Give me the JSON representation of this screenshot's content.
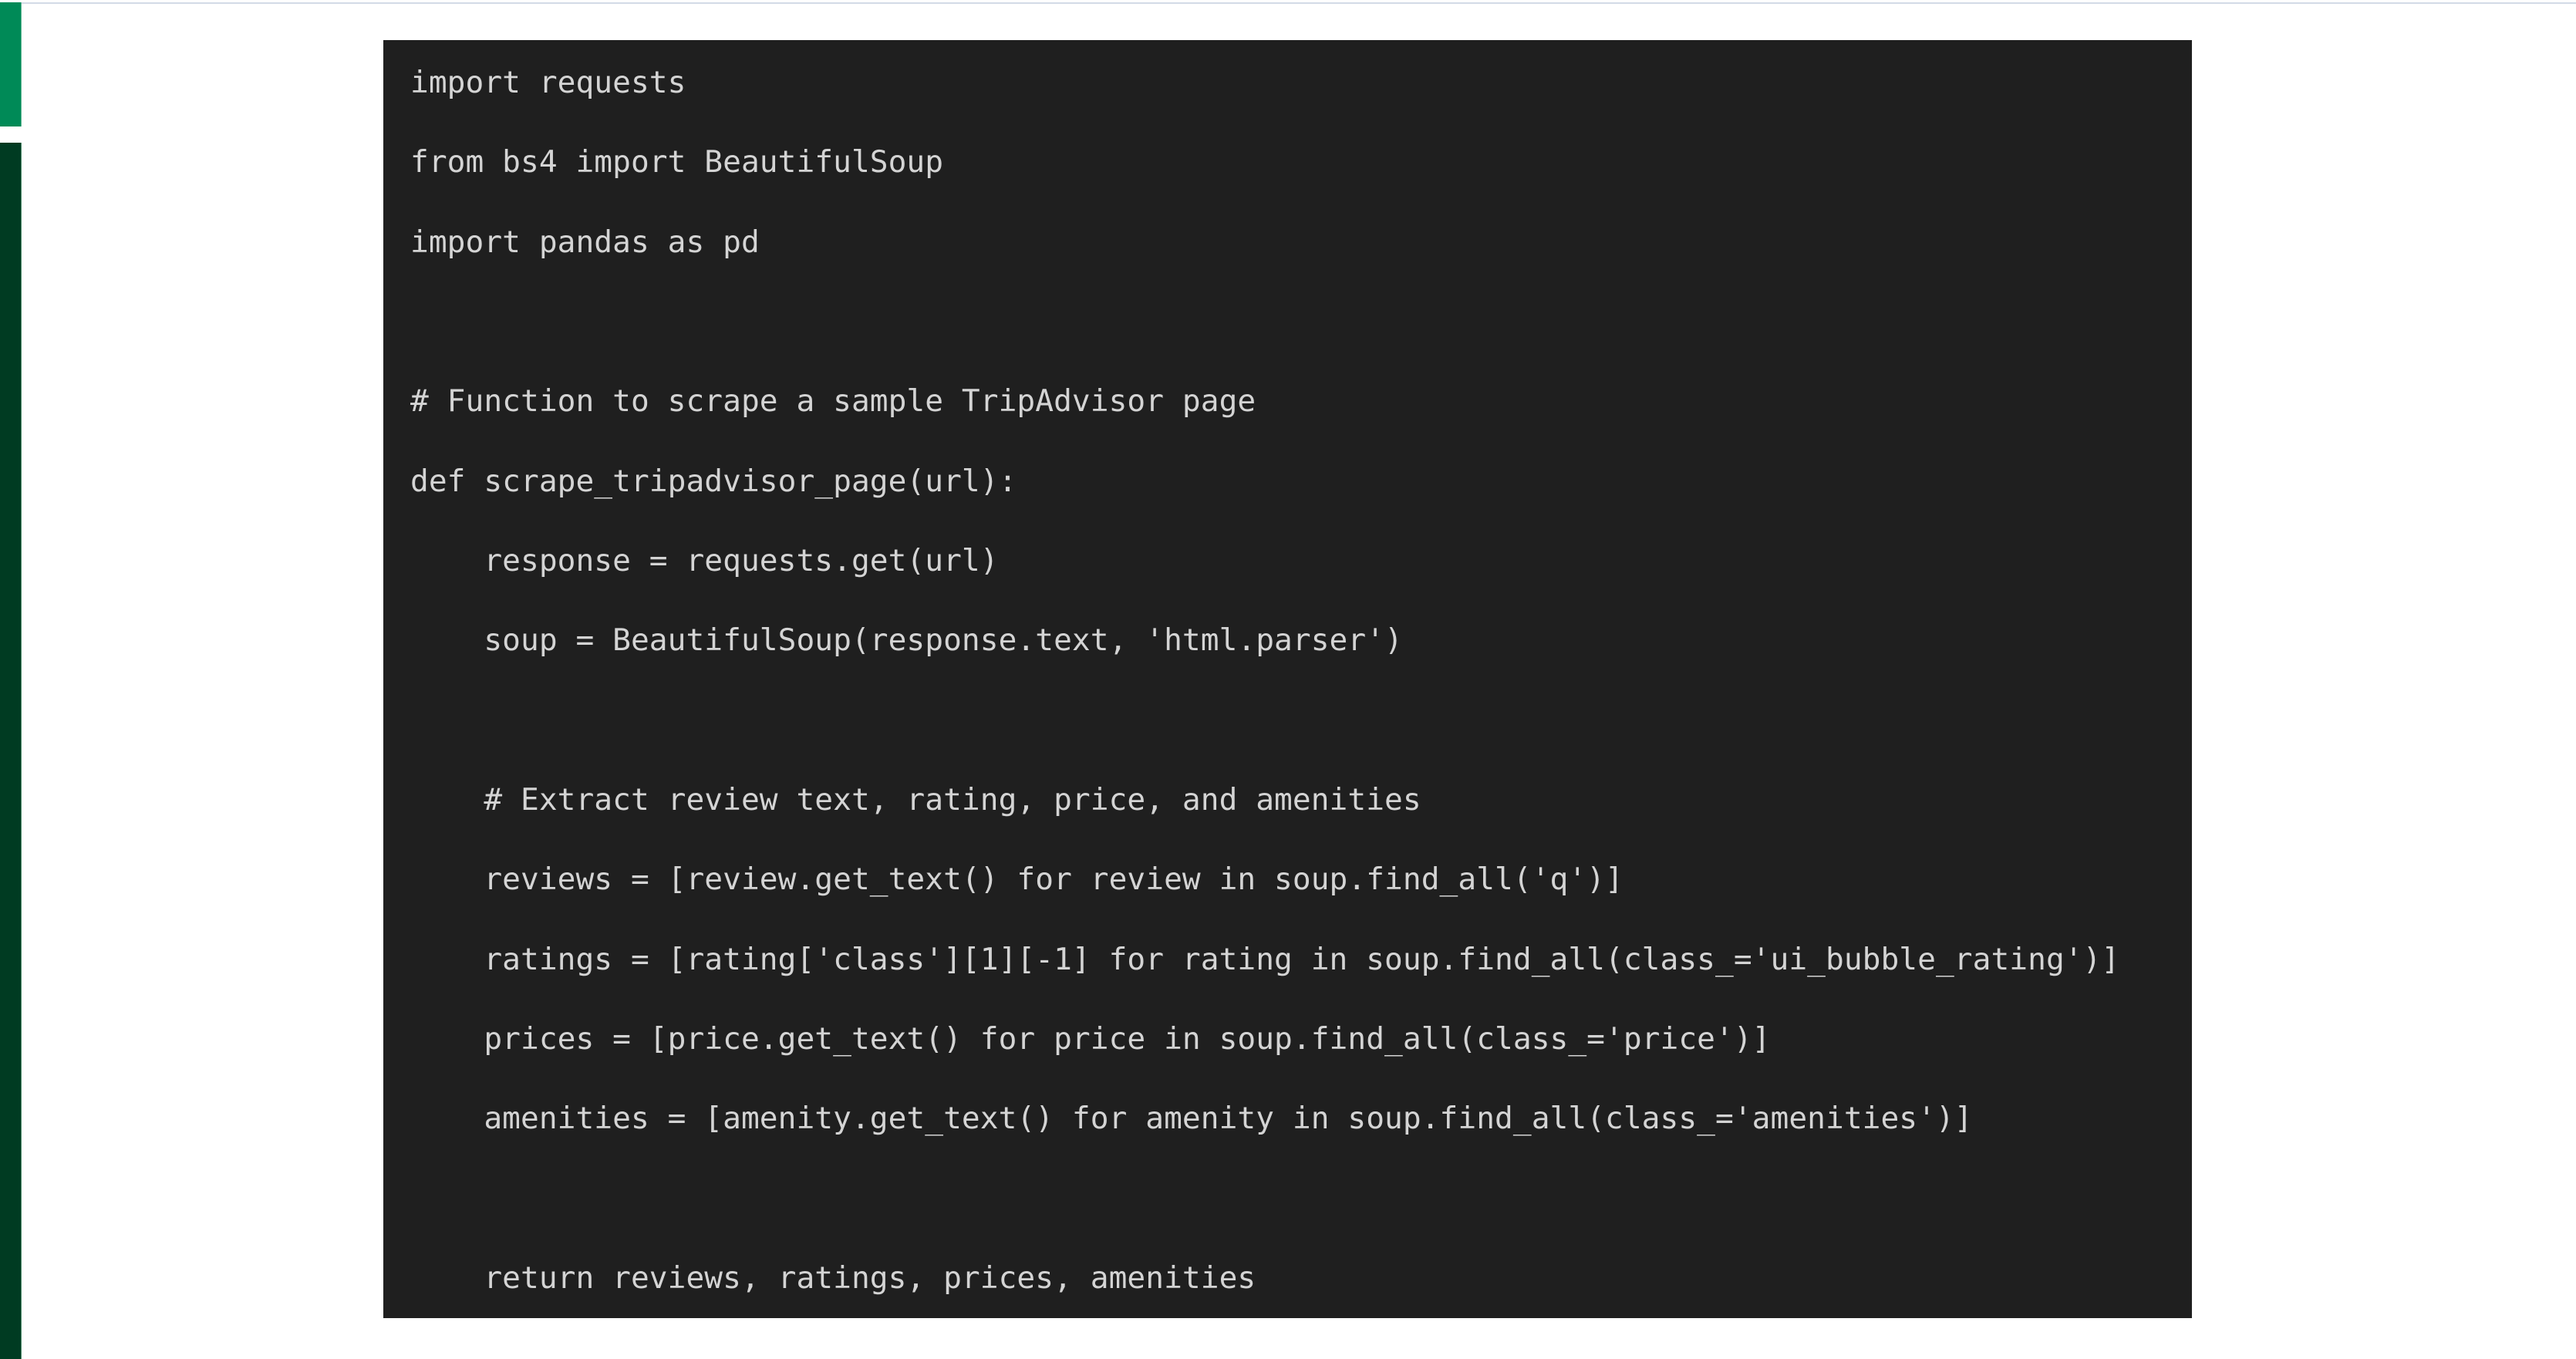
{
  "colors": {
    "rail_accent": "#008a57",
    "rail_dark": "#003b22",
    "code_background": "#1f1f1f",
    "code_text": "#d4d4d4"
  },
  "code": {
    "language": "python",
    "lines": [
      "import requests",
      "from bs4 import BeautifulSoup",
      "import pandas as pd",
      "",
      "# Function to scrape a sample TripAdvisor page",
      "def scrape_tripadvisor_page(url):",
      "    response = requests.get(url)",
      "    soup = BeautifulSoup(response.text, 'html.parser')",
      "",
      "    # Extract review text, rating, price, and amenities",
      "    reviews = [review.get_text() for review in soup.find_all('q')]",
      "    ratings = [rating['class'][1][-1] for rating in soup.find_all(class_='ui_bubble_rating')]",
      "    prices = [price.get_text() for price in soup.find_all(class_='price')]",
      "    amenities = [amenity.get_text() for amenity in soup.find_all(class_='amenities')]",
      "",
      "    return reviews, ratings, prices, amenities"
    ]
  }
}
